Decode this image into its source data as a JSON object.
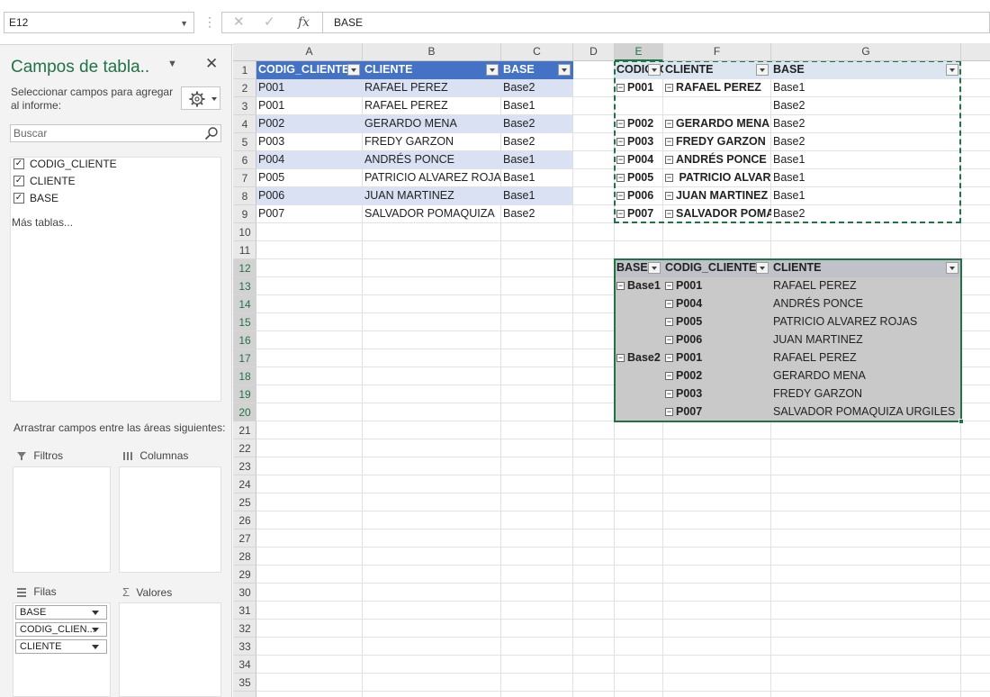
{
  "formula_bar": {
    "name_box": "E12",
    "cancel_icon": "✕",
    "enter_icon": "✓",
    "fx_label": "fx",
    "formula": "BASE"
  },
  "pivot_pane": {
    "title": "Campos de tabla..",
    "close": "✕",
    "subtitle": "Seleccionar campos para agregar al informe:",
    "search_placeholder": "Buscar",
    "fields": [
      "CODIG_CLIENTE",
      "CLIENTE",
      "BASE"
    ],
    "more_tables": "Más tablas...",
    "drag_label": "Arrastrar campos entre las áreas siguientes:",
    "areas": {
      "filters": "Filtros",
      "columns": "Columnas",
      "rows": "Filas",
      "values": "Valores"
    },
    "row_fields": [
      "BASE",
      "CODIG_CLIEN...",
      "CLIENTE"
    ]
  },
  "columns": [
    "A",
    "B",
    "C",
    "D",
    "E",
    "F",
    "G"
  ],
  "rows": [
    1,
    2,
    3,
    4,
    5,
    6,
    7,
    8,
    9,
    10,
    11,
    12,
    13,
    14,
    15,
    16,
    17,
    18,
    19,
    20,
    21,
    22,
    23,
    24,
    25,
    26,
    27,
    28,
    29,
    30,
    31,
    32,
    33,
    34,
    35
  ],
  "table1": {
    "headers": [
      "CODIG_CLIENTE",
      "CLIENTE",
      "BASE"
    ],
    "rows": [
      [
        "P001",
        "RAFAEL PEREZ",
        "Base2"
      ],
      [
        "P001",
        "RAFAEL PEREZ",
        "Base1"
      ],
      [
        "P002",
        "GERARDO MENA",
        "Base2"
      ],
      [
        "P003",
        "FREDY GARZON",
        "Base2"
      ],
      [
        "P004",
        "ANDRÉS PONCE",
        "Base1"
      ],
      [
        "P005",
        " PATRICIO ALVAREZ ROJAS",
        "Base1"
      ],
      [
        "P006",
        "JUAN MARTINEZ",
        "Base1"
      ],
      [
        "P007",
        "SALVADOR POMAQUIZA",
        "Base2"
      ]
    ]
  },
  "pivot1": {
    "headers": [
      "CODIG_CLIENTE",
      "CLIENTE",
      "BASE"
    ],
    "rows": [
      [
        "P001",
        "RAFAEL PEREZ",
        "Base1"
      ],
      [
        "",
        "",
        "Base2"
      ],
      [
        "P002",
        "GERARDO MENA",
        "Base2"
      ],
      [
        "P003",
        "FREDY GARZON",
        "Base2"
      ],
      [
        "P004",
        "ANDRÉS PONCE",
        "Base1"
      ],
      [
        "P005",
        " PATRICIO ALVAREZ ROJAS",
        "Base1"
      ],
      [
        "P006",
        "JUAN MARTINEZ",
        "Base1"
      ],
      [
        "P007",
        "SALVADOR POMAQUIZA URGILES",
        "Base2"
      ]
    ]
  },
  "pivot2": {
    "headers": [
      "BASE",
      "CODIG_CLIENTE",
      "CLIENTE"
    ],
    "rows": [
      [
        "Base1",
        "P001",
        "RAFAEL PEREZ"
      ],
      [
        "",
        "P004",
        "ANDRÉS PONCE"
      ],
      [
        "",
        "P005",
        " PATRICIO ALVAREZ ROJAS"
      ],
      [
        "",
        "P006",
        "JUAN MARTINEZ"
      ],
      [
        "Base2",
        "P001",
        "RAFAEL PEREZ"
      ],
      [
        "",
        "P002",
        "GERARDO MENA"
      ],
      [
        "",
        "P003",
        "FREDY GARZON"
      ],
      [
        "",
        "P007",
        "SALVADOR POMAQUIZA URGILES"
      ]
    ]
  }
}
